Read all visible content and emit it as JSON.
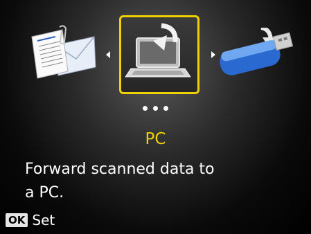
{
  "menu": {
    "items": [
      {
        "icon": "document-envelope-icon"
      },
      {
        "icon": "laptop-pc-icon",
        "selected": true
      },
      {
        "icon": "usb-flash-drive-icon"
      }
    ],
    "title": "PC",
    "description_line1": "Forward scanned data to",
    "description_line2": "a PC.",
    "page_indicator_count": 3
  },
  "footer": {
    "ok_label": "OK",
    "set_label": "Set"
  },
  "colors": {
    "accent": "#f0d000",
    "background": "#000000",
    "text": "#ffffff"
  }
}
